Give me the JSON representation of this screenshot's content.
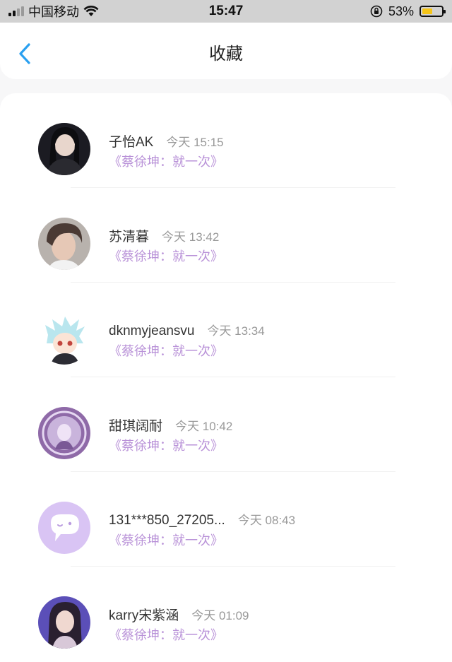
{
  "status_bar": {
    "carrier": "中国移动",
    "time": "15:47",
    "battery_percent": "53%",
    "battery_level": 0.53,
    "icons": [
      "signal-icon",
      "wifi-icon",
      "rotation-lock-icon",
      "battery-icon"
    ]
  },
  "header": {
    "title": "收藏",
    "back_icon": "chevron-left-icon",
    "accent_color": "#2aa0f0"
  },
  "colors": {
    "song_link": "#b992d8",
    "time_text": "#999999"
  },
  "favorites": [
    {
      "name": "子怡AK",
      "time": "今天 15:15",
      "song": "《蔡徐坤：就一次》",
      "avatar": "photo-avatar-dark"
    },
    {
      "name": "苏清暮",
      "time": "今天 13:42",
      "song": "《蔡徐坤：就一次》",
      "avatar": "photo-avatar-boy"
    },
    {
      "name": "dknmyjeansvu",
      "time": "今天 13:34",
      "song": "《蔡徐坤：就一次》",
      "avatar": "anime-avatar-catboy"
    },
    {
      "name": "甜琪阔耐",
      "time": "今天 10:42",
      "song": "《蔡徐坤：就一次》",
      "avatar": "photo-avatar-purple-frame"
    },
    {
      "name": "131***850_27205...",
      "time": "今天 08:43",
      "song": "《蔡徐坤：就一次》",
      "avatar": "default-chat-avatar"
    },
    {
      "name": "karry宋紫涵",
      "time": "今天 01:09",
      "song": "《蔡徐坤：就一次》",
      "avatar": "illustrated-avatar-girl"
    }
  ]
}
